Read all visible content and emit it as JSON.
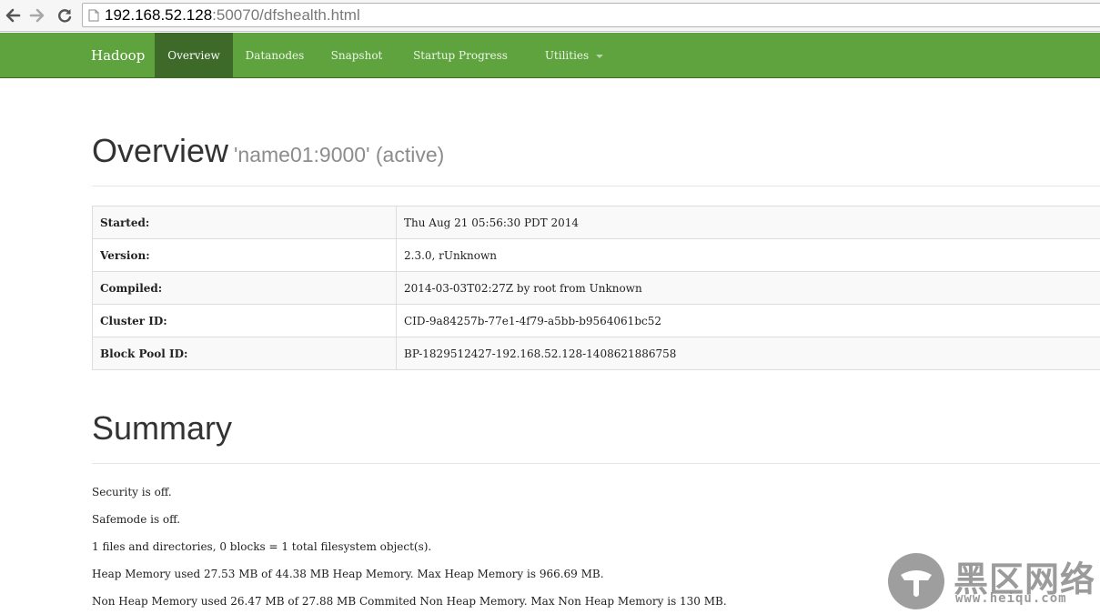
{
  "browser": {
    "url_host": "192.168.52.128",
    "url_rest": ":50070/dfshealth.html"
  },
  "navbar": {
    "brand": "Hadoop",
    "items": [
      {
        "label": "Overview",
        "active": true
      },
      {
        "label": "Datanodes"
      },
      {
        "label": "Snapshot"
      },
      {
        "label": "Startup Progress"
      },
      {
        "label": "Utilities",
        "dropdown": true
      }
    ],
    "colors": {
      "background": "#5fa33e",
      "active": "#3d6a28"
    }
  },
  "overview": {
    "title": "Overview",
    "subtitle": "'name01:9000' (active)",
    "rows": [
      {
        "key": "Started:",
        "value": "Thu Aug 21 05:56:30 PDT 2014"
      },
      {
        "key": "Version:",
        "value": "2.3.0, rUnknown"
      },
      {
        "key": "Compiled:",
        "value": "2014-03-03T02:27Z by root from Unknown"
      },
      {
        "key": "Cluster ID:",
        "value": "CID-9a84257b-77e1-4f79-a5bb-b9564061bc52"
      },
      {
        "key": "Block Pool ID:",
        "value": "BP-1829512427-192.168.52.128-1408621886758"
      }
    ]
  },
  "summary": {
    "title": "Summary",
    "lines": [
      "Security is off.",
      "Safemode is off.",
      "1 files and directories, 0 blocks = 1 total filesystem object(s).",
      "Heap Memory used 27.53 MB of 44.38 MB Heap Memory. Max Heap Memory is 966.69 MB.",
      "Non Heap Memory used 26.47 MB of 27.88 MB Commited Non Heap Memory. Max Non Heap Memory is 130 MB."
    ]
  },
  "watermark": {
    "name": "黑区网络",
    "url": "www.heiqu.com"
  }
}
